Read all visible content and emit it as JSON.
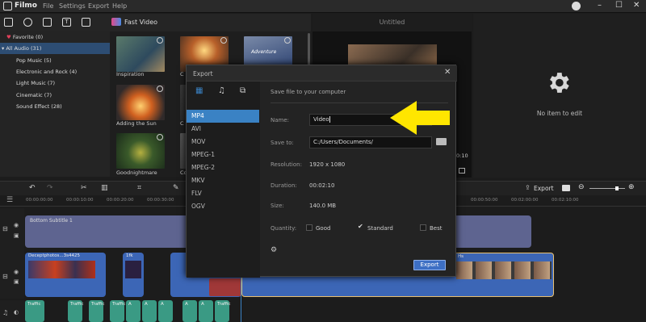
{
  "app": {
    "name": "Filmo",
    "menu": [
      "File",
      "Settings",
      "Export",
      "Help"
    ]
  },
  "toolbar": {
    "fast_video": "Fast Video"
  },
  "sidebar": {
    "items": [
      {
        "label": "Favorite (0)"
      },
      {
        "label": "All Audio (31)"
      },
      {
        "label": "Pop Music (5)"
      },
      {
        "label": "Electronic and Rock (4)"
      },
      {
        "label": "Light Music (7)"
      },
      {
        "label": "Cinematic (7)"
      },
      {
        "label": "Sound Effect (28)"
      }
    ]
  },
  "media": {
    "thumbs": [
      {
        "label": "Inspiration"
      },
      {
        "label": "C"
      },
      {
        "label": "Adventure"
      },
      {
        "label": "Adding the Sun"
      },
      {
        "label": "C"
      },
      {
        "label": "Goodnightmare"
      },
      {
        "label": "Co"
      }
    ]
  },
  "preview": {
    "title": "Untitled",
    "time": "0:10"
  },
  "properties": {
    "empty_text": "No item to edit"
  },
  "timeline": {
    "export_label": "Export",
    "ruler": [
      "00:00:00:00",
      "00:00:10:00",
      "00:00:20:00",
      "00:00:30:00",
      "00:00:50:00",
      "00:02:00:00",
      "00:02:10:00"
    ],
    "subtitle_clip": "Bottom Subtitle 1",
    "video_clip": "Deceptphotos...3s4425",
    "clip_small": "1fk",
    "clip_end": "Hs",
    "audio": [
      "Traffic",
      "Traffic",
      "Traffic",
      "Traffic",
      "A",
      "A",
      "A",
      "A",
      "A",
      "Traffic",
      "Traffic",
      "A"
    ]
  },
  "dialog": {
    "title": "Export",
    "formats": [
      "MP4",
      "AVI",
      "MOV",
      "MPEG-1",
      "MPEG-2",
      "MKV",
      "FLV",
      "OGV"
    ],
    "selected_format": "MP4",
    "heading": "Save file to your computer",
    "name_label": "Name:",
    "name_value": "Video",
    "saveto_label": "Save to:",
    "saveto_value": "C:/Users/Documents/",
    "resolution_label": "Resolution:",
    "resolution_value": "1920 x 1080",
    "duration_label": "Duration:",
    "duration_value": "00:02:10",
    "size_label": "Size:",
    "size_value": "140.0 MB",
    "quality_label": "Quantity:",
    "quality_options": [
      "Good",
      "Standard",
      "Best"
    ],
    "quality_selected": "Standard",
    "export_button": "Export"
  },
  "colors": {
    "accent": "#3d6fc4",
    "selection": "#3a82c4",
    "arrow": "#ffe600",
    "clip_blue": "#3c66b6",
    "clip_purple": "#5e6490",
    "audio_teal": "#3a9a84"
  }
}
